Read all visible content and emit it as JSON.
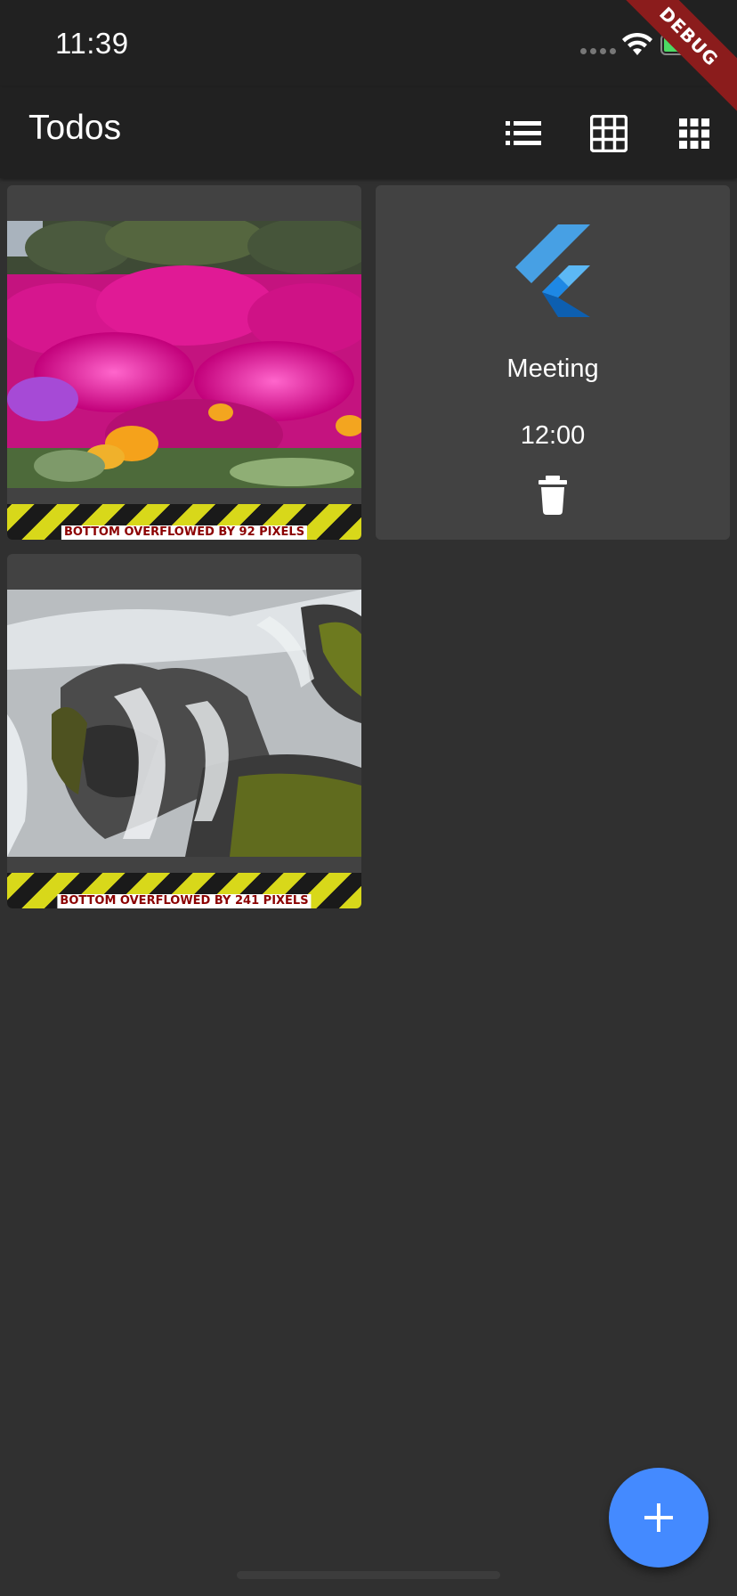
{
  "status_bar": {
    "time": "11:39",
    "icons": [
      "signal-icon",
      "wifi-icon",
      "battery-charging-icon"
    ],
    "debug_banner": "DEBUG"
  },
  "app_bar": {
    "title": "Todos",
    "actions": [
      "list-view-icon",
      "grid-view-icon",
      "apps-view-icon"
    ]
  },
  "todos": [
    {
      "type": "image",
      "image": "pink-flowers-photo",
      "overflow_text": "BOTTOM OVERFLOWED BY 92 PIXELS"
    },
    {
      "type": "note",
      "icon": "flutter-logo",
      "title": "Meeting",
      "time": "12:00",
      "action": "delete-icon"
    },
    {
      "type": "image",
      "image": "waterfall-rocks-photo",
      "overflow_text": "BOTTOM OVERFLOWED BY 241 PIXELS"
    }
  ],
  "fab": {
    "icon": "add-icon"
  },
  "colors": {
    "background": "#303030",
    "app_bar": "#212121",
    "card": "#424242",
    "fab": "#448aff",
    "debug_banner": "#8b1c1c",
    "overflow_stripe_yellow": "#d8d81a",
    "overflow_text": "#8b0000"
  }
}
